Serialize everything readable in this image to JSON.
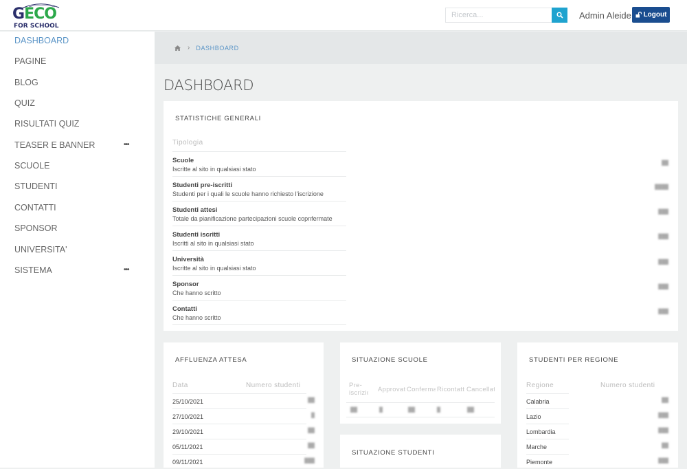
{
  "header": {
    "logo_main_first": "G",
    "logo_main_rest": "ECO",
    "logo_sub": "FOR SCHOOL",
    "search_placeholder": "Ricerca...",
    "user_name": "Admin Aleide",
    "logout_label": "Logout"
  },
  "colors": {
    "accent": "#5b95c7",
    "search_button": "#1fa3cf",
    "logout_button": "#1a4d8f",
    "logo_navy": "#2b2f6b",
    "logo_green": "#2ca84a"
  },
  "sidebar": {
    "items": [
      {
        "label": "DASHBOARD",
        "active": true,
        "has_submenu": false
      },
      {
        "label": "PAGINE",
        "active": false,
        "has_submenu": false
      },
      {
        "label": "BLOG",
        "active": false,
        "has_submenu": false
      },
      {
        "label": "QUIZ",
        "active": false,
        "has_submenu": false
      },
      {
        "label": "RISULTATI QUIZ",
        "active": false,
        "has_submenu": false
      },
      {
        "label": "TEASER E BANNER",
        "active": false,
        "has_submenu": true
      },
      {
        "label": "SCUOLE",
        "active": false,
        "has_submenu": false
      },
      {
        "label": "STUDENTI",
        "active": false,
        "has_submenu": false
      },
      {
        "label": "CONTATTI",
        "active": false,
        "has_submenu": false
      },
      {
        "label": "SPONSOR",
        "active": false,
        "has_submenu": false
      },
      {
        "label": "UNIVERSITA'",
        "active": false,
        "has_submenu": false
      },
      {
        "label": "SISTEMA",
        "active": false,
        "has_submenu": true
      }
    ],
    "submenu_glyph": "•••"
  },
  "breadcrumb": {
    "home_icon": "home-icon",
    "separator": "›",
    "current": "DASHBOARD"
  },
  "page_title": "DASHBOARD",
  "stats": {
    "title": "STATISTICHE GENERALI",
    "column_header": "Tipologia",
    "rows": [
      {
        "title": "Scuole",
        "desc": "Iscritte al sito in qualsiasi stato",
        "value": "██"
      },
      {
        "title": "Studenti pre-iscritti",
        "desc": "Studenti per i quali le scuole hanno richiesto l'iscrizione",
        "value": "████"
      },
      {
        "title": "Studenti attesi",
        "desc": "Totale da pianificazione partecipazioni scuole copnfermate",
        "value": "███"
      },
      {
        "title": "Studenti iscritti",
        "desc": "Iscritti al sito in qualsiasi stato",
        "value": "███"
      },
      {
        "title": "Università",
        "desc": "Iscritte al sito in qualsiasi stato",
        "value": "███"
      },
      {
        "title": "Sponsor",
        "desc": "Che hanno scritto",
        "value": "███"
      },
      {
        "title": "Contatti",
        "desc": "Che hanno scritto",
        "value": "███"
      }
    ]
  },
  "affluenza": {
    "title": "AFFLUENZA ATTESA",
    "headers": [
      "Data",
      "Numero studenti"
    ],
    "rows": [
      {
        "date": "25/10/2021",
        "value": "██"
      },
      {
        "date": "27/10/2021",
        "value": "█"
      },
      {
        "date": "29/10/2021",
        "value": "██"
      },
      {
        "date": "05/11/2021",
        "value": "██"
      },
      {
        "date": "09/11/2021",
        "value": "███"
      }
    ]
  },
  "situazione_scuole": {
    "title": "SITUAZIONE SCUOLE",
    "headers": [
      "Pre-iscrizioni",
      "Approvate",
      "Confermate",
      "Ricontattare",
      "Cancellate"
    ],
    "values": [
      "██",
      "█",
      "██",
      "█",
      "██"
    ]
  },
  "situazione_studenti": {
    "title": "SITUAZIONE STUDENTI"
  },
  "regioni": {
    "title": "STUDENTI PER REGIONE",
    "headers": [
      "Regione",
      "Numero studenti"
    ],
    "rows": [
      {
        "region": "Calabria",
        "value": "██"
      },
      {
        "region": "Lazio",
        "value": "███"
      },
      {
        "region": "Lombardia",
        "value": "███"
      },
      {
        "region": "Marche",
        "value": "██"
      },
      {
        "region": "Piemonte",
        "value": "███"
      }
    ]
  }
}
